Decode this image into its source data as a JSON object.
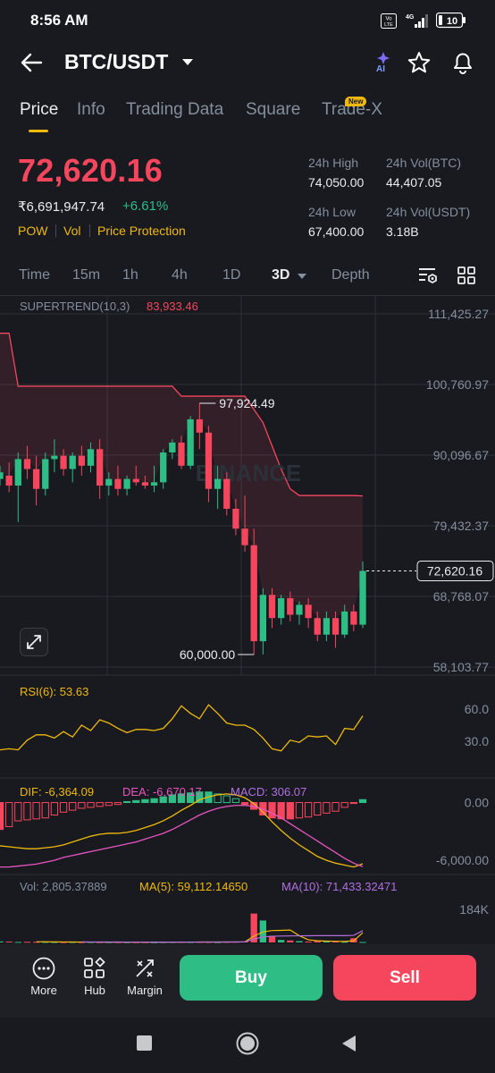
{
  "status_bar": {
    "time": "8:56 AM",
    "volte_label": "Vo LTE",
    "network_label": "4G",
    "battery": "10"
  },
  "header": {
    "pair": "BTC/USDT",
    "ai_label": "AI"
  },
  "tabs": [
    {
      "label": "Price",
      "active": true
    },
    {
      "label": "Info",
      "active": false
    },
    {
      "label": "Trading Data",
      "active": false
    },
    {
      "label": "Square",
      "active": false
    },
    {
      "label": "Trade-X",
      "active": false,
      "badge": "New"
    }
  ],
  "ticker": {
    "last_price": "72,620.16",
    "fiat_price": "₹6,691,947.74",
    "change_pct": "+6.61%",
    "tags": [
      "POW",
      "Vol",
      "Price Protection"
    ],
    "high_label": "24h High",
    "high_value": "74,050.00",
    "vol_btc_label": "24h Vol(BTC)",
    "vol_btc_value": "44,407.05",
    "low_label": "24h Low",
    "low_value": "67,400.00",
    "vol_usdt_label": "24h Vol(USDT)",
    "vol_usdt_value": "3.18B"
  },
  "intervals": [
    {
      "label": "Time",
      "active": false
    },
    {
      "label": "15m",
      "active": false
    },
    {
      "label": "1h",
      "active": false
    },
    {
      "label": "4h",
      "active": false
    },
    {
      "label": "1D",
      "active": false
    },
    {
      "label": "3D",
      "active": true
    },
    {
      "label": "Depth",
      "active": false
    }
  ],
  "chart": {
    "supertrend_label": "SUPERTREND(10,3)",
    "supertrend_value": "83,933.46",
    "watermark": "BINANCE",
    "price_axis": [
      "111,425.27",
      "100,760.97",
      "90,096.67",
      "79,432.37",
      "68,768.07",
      "58,103.77"
    ],
    "price_axis_values": [
      111425.27,
      100760.97,
      90096.67,
      79432.37,
      68768.07,
      58103.77
    ],
    "current_price_tag": "72,620.16",
    "high_marker": "97,924.49",
    "low_marker": "60,000.00",
    "rsi_label": "RSI(6): 53.63",
    "rsi_axis": [
      "60.0",
      "30.0"
    ],
    "macd_dif": "DIF: -6,364.09",
    "macd_dea": "DEA: -6,670.17",
    "macd_macd": "MACD: 306.07",
    "macd_axis": [
      "0.00",
      "-6,000.00"
    ],
    "vol_label": "Vol: 2,805.37889",
    "vol_ma5": "MA(5): 59,112.14650",
    "vol_ma10": "MA(10): 71,433.32471",
    "vol_axis": [
      "184K"
    ]
  },
  "chart_data": {
    "type": "candlestick",
    "interval": "3D",
    "ylim": [
      58103.77,
      111425.27
    ],
    "candles": [
      {
        "o": 86500,
        "h": 88500,
        "l": 85500,
        "c": 87500
      },
      {
        "o": 87000,
        "h": 89000,
        "l": 84500,
        "c": 85500
      },
      {
        "o": 85500,
        "h": 90500,
        "l": 80000,
        "c": 89500
      },
      {
        "o": 89500,
        "h": 91500,
        "l": 86500,
        "c": 88000
      },
      {
        "o": 88000,
        "h": 90000,
        "l": 82500,
        "c": 85000
      },
      {
        "o": 85000,
        "h": 90500,
        "l": 84000,
        "c": 89500
      },
      {
        "o": 89500,
        "h": 92500,
        "l": 87500,
        "c": 90000
      },
      {
        "o": 90000,
        "h": 91000,
        "l": 87000,
        "c": 88000
      },
      {
        "o": 88000,
        "h": 90500,
        "l": 86000,
        "c": 90000
      },
      {
        "o": 90000,
        "h": 91500,
        "l": 87000,
        "c": 88500
      },
      {
        "o": 88500,
        "h": 92000,
        "l": 87500,
        "c": 91000
      },
      {
        "o": 91000,
        "h": 92500,
        "l": 83500,
        "c": 85500
      },
      {
        "o": 85500,
        "h": 87500,
        "l": 84000,
        "c": 86500
      },
      {
        "o": 86500,
        "h": 88500,
        "l": 84000,
        "c": 85000
      },
      {
        "o": 85000,
        "h": 87000,
        "l": 84000,
        "c": 86500
      },
      {
        "o": 86500,
        "h": 88500,
        "l": 85500,
        "c": 86000
      },
      {
        "o": 86000,
        "h": 87000,
        "l": 85000,
        "c": 85500
      },
      {
        "o": 85500,
        "h": 88500,
        "l": 84500,
        "c": 86000
      },
      {
        "o": 86000,
        "h": 91000,
        "l": 85000,
        "c": 90500
      },
      {
        "o": 90500,
        "h": 92500,
        "l": 89500,
        "c": 92000
      },
      {
        "o": 92000,
        "h": 93000,
        "l": 88000,
        "c": 88500
      },
      {
        "o": 88500,
        "h": 96000,
        "l": 88000,
        "c": 95500
      },
      {
        "o": 95500,
        "h": 97924.49,
        "l": 91000,
        "c": 93500
      },
      {
        "o": 93500,
        "h": 94500,
        "l": 83000,
        "c": 85000
      },
      {
        "o": 85000,
        "h": 88500,
        "l": 82000,
        "c": 86500
      },
      {
        "o": 86500,
        "h": 87500,
        "l": 81000,
        "c": 82000
      },
      {
        "o": 82000,
        "h": 83500,
        "l": 78000,
        "c": 79000
      },
      {
        "o": 79000,
        "h": 84000,
        "l": 75500,
        "c": 76500
      },
      {
        "o": 76500,
        "h": 79000,
        "l": 60000,
        "c": 62000
      },
      {
        "o": 62000,
        "h": 70000,
        "l": 60000,
        "c": 69000
      },
      {
        "o": 69000,
        "h": 70000,
        "l": 64000,
        "c": 65500
      },
      {
        "o": 65500,
        "h": 69000,
        "l": 64500,
        "c": 68500
      },
      {
        "o": 68500,
        "h": 69500,
        "l": 65000,
        "c": 66000
      },
      {
        "o": 66000,
        "h": 68000,
        "l": 64500,
        "c": 67500
      },
      {
        "o": 67500,
        "h": 68500,
        "l": 64000,
        "c": 65500
      },
      {
        "o": 65500,
        "h": 66500,
        "l": 62000,
        "c": 63000
      },
      {
        "o": 63000,
        "h": 66500,
        "l": 62000,
        "c": 65500
      },
      {
        "o": 65500,
        "h": 66500,
        "l": 61000,
        "c": 63000
      },
      {
        "o": 63000,
        "h": 67500,
        "l": 62500,
        "c": 66500
      },
      {
        "o": 66500,
        "h": 67500,
        "l": 63500,
        "c": 64500
      },
      {
        "o": 64500,
        "h": 74050,
        "l": 64000,
        "c": 72620.16
      }
    ],
    "supertrend": [
      108500,
      108500,
      100500,
      100500,
      100500,
      100500,
      100500,
      100500,
      100500,
      100500,
      100500,
      100500,
      100500,
      100500,
      100500,
      100500,
      100500,
      100500,
      100500,
      100500,
      99000,
      99000,
      99000,
      99000,
      99000,
      99000,
      99000,
      99000,
      97000,
      95000,
      91500,
      88000,
      85000,
      84000,
      84000,
      84000,
      84000,
      84000,
      84000,
      84000,
      83933.46
    ],
    "rsi": [
      22,
      23,
      22,
      31,
      36,
      36,
      33,
      39,
      34,
      45,
      40,
      50,
      47,
      42,
      38,
      41,
      41,
      40,
      42,
      51,
      63,
      56,
      51,
      64,
      56,
      47,
      45,
      45,
      41,
      33,
      23,
      21,
      31,
      29,
      35,
      34,
      35,
      27,
      42,
      41,
      53.63
    ],
    "rsi_ylim": [
      0,
      75
    ],
    "macd_hist": [
      -2800,
      -2500,
      -1900,
      -1800,
      -1700,
      -1600,
      -1300,
      -1000,
      -800,
      -600,
      -500,
      -400,
      -300,
      -200,
      100,
      200,
      300,
      400,
      600,
      800,
      900,
      1000,
      1100,
      1100,
      900,
      700,
      400,
      -200,
      -700,
      -1300,
      -1600,
      -1700,
      -1700,
      -1600,
      -1500,
      -1300,
      -1100,
      -900,
      -500,
      -100,
      306.07
    ],
    "macd_dif": [
      -4500,
      -4600,
      -4700,
      -4800,
      -4800,
      -4700,
      -4600,
      -4400,
      -4100,
      -3800,
      -3500,
      -3300,
      -3200,
      -3200,
      -3100,
      -2900,
      -2600,
      -2300,
      -1900,
      -1400,
      -800,
      -300,
      300,
      600,
      800,
      900,
      800,
      500,
      -100,
      -1000,
      -2000,
      -2900,
      -3700,
      -4400,
      -5000,
      -5600,
      -6000,
      -6300,
      -6500,
      -6700,
      -6364.09
    ],
    "macd_dea": [
      -6700,
      -6700,
      -6600,
      -6500,
      -6400,
      -6200,
      -6000,
      -5700,
      -5500,
      -5300,
      -5100,
      -4900,
      -4700,
      -4500,
      -4300,
      -4100,
      -3800,
      -3500,
      -3200,
      -2800,
      -2300,
      -1800,
      -1300,
      -900,
      -600,
      -400,
      -300,
      -300,
      -400,
      -700,
      -1100,
      -1600,
      -2200,
      -2800,
      -3400,
      -4000,
      -4600,
      -5200,
      -5800,
      -6300,
      -6670.17
    ],
    "macd_ylim": [
      -7200,
      700
    ],
    "volume": [
      6000,
      5000,
      3000,
      4000,
      3500,
      3000,
      2500,
      2000,
      2500,
      2000,
      2500,
      2200,
      2000,
      2000,
      2000,
      1800,
      2000,
      1500,
      2000,
      2500,
      3000,
      2500,
      3000,
      2800,
      2000,
      3500,
      4000,
      6000,
      175000,
      133000,
      40000,
      15000,
      12000,
      8000,
      5000,
      8000,
      6000,
      7000,
      4000,
      26000,
      2805
    ],
    "vol_ma5": [
      null,
      null,
      null,
      null,
      4300,
      3900,
      3200,
      3000,
      2700,
      2400,
      2300,
      2200,
      2200,
      2200,
      2100,
      2000,
      2000,
      1900,
      1900,
      2000,
      2200,
      2300,
      2600,
      2800,
      2700,
      2800,
      3100,
      3700,
      38000,
      64000,
      72000,
      73000,
      75000,
      41000,
      16000,
      10000,
      8000,
      7000,
      6000,
      10000,
      59112.1465
    ],
    "vol_ma10": [
      null,
      null,
      null,
      null,
      null,
      null,
      null,
      null,
      null,
      3500,
      3100,
      2900,
      2800,
      2600,
      2500,
      2400,
      2300,
      2200,
      2200,
      2200,
      2200,
      2300,
      2400,
      2500,
      2500,
      2700,
      2900,
      3300,
      20500,
      33500,
      37500,
      38800,
      39700,
      40300,
      40600,
      41100,
      41300,
      41400,
      41400,
      43000,
      71433.32471
    ],
    "vol_ylim": [
      0,
      184000
    ]
  },
  "colors": {
    "up": "#2ebd85",
    "down": "#f6465d",
    "accent": "#f0b90b",
    "ma5": "#f0b90b",
    "ma10": "#b16fe0",
    "dea": "#e855c0"
  },
  "bottom_nav": [
    {
      "label": "More",
      "icon": "more-icon"
    },
    {
      "label": "Hub",
      "icon": "hub-icon"
    },
    {
      "label": "Margin",
      "icon": "margin-icon"
    }
  ],
  "actions": {
    "buy": "Buy",
    "sell": "Sell"
  }
}
